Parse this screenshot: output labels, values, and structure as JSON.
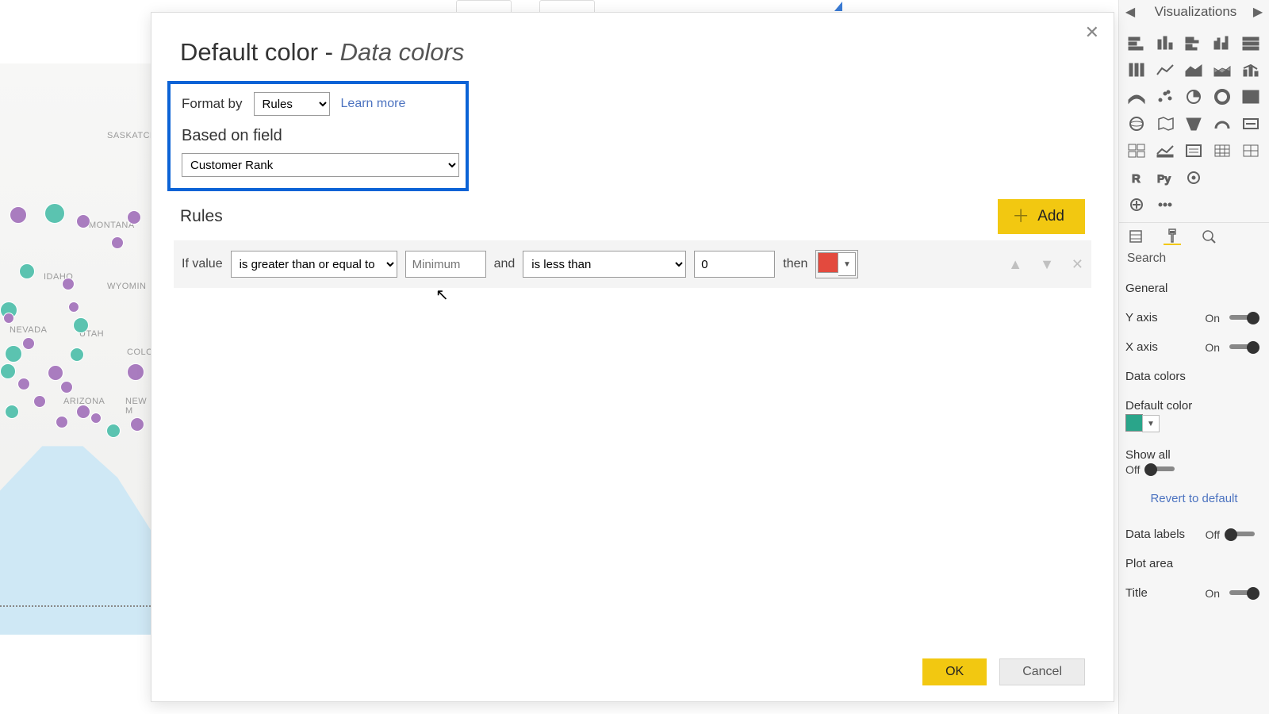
{
  "viz": {
    "title": "Visualizations",
    "tabs_search": "Search",
    "revert": "Revert to default",
    "rows": [
      {
        "label": "General",
        "toggle": null
      },
      {
        "label": "Y axis",
        "toggle": "On"
      },
      {
        "label": "X axis",
        "toggle": "On"
      },
      {
        "label": "Data colors",
        "toggle": null
      },
      {
        "label": "Default color",
        "toggle": null
      },
      {
        "label": "Show all",
        "toggle": null
      },
      {
        "label": "Off",
        "toggle": null
      },
      {
        "label": "Data labels",
        "toggle": "Off"
      },
      {
        "label": "Plot area",
        "toggle": null
      },
      {
        "label": "Title",
        "toggle": "On"
      }
    ]
  },
  "dialog": {
    "title_a": "Default color - ",
    "title_b": "Data colors",
    "format_by_label": "Format by",
    "format_by_value": "Rules",
    "learn": "Learn more",
    "based_on_label": "Based on field",
    "based_on_value": "Customer Rank",
    "rules_label": "Rules",
    "add_label": "Add",
    "rule": {
      "if": "If value",
      "op1": "is greater than or equal to",
      "val1_placeholder": "Minimum",
      "and": "and",
      "op2": "is less than",
      "val2": "0",
      "then": "then",
      "color": "#e34a3e"
    },
    "ok": "OK",
    "cancel": "Cancel"
  },
  "map_labels": {
    "saskatch": "SASKATCH",
    "montana": "MONTANA",
    "idaho": "IDAHO",
    "wyomin": "WYOMIN",
    "nevada": "NEVADA",
    "utah": "UTAH",
    "coloi": "COLOI",
    "arizona": "ARIZONA",
    "newm": "NEW M"
  }
}
